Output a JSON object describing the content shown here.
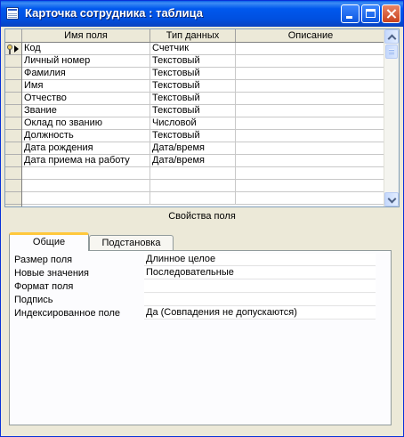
{
  "window": {
    "title": "Карточка сотрудника : таблица"
  },
  "grid": {
    "headers": [
      "Имя поля",
      "Тип данных",
      "Описание"
    ],
    "rows": [
      {
        "name": "Код",
        "type": "Счетчик",
        "desc": ""
      },
      {
        "name": "Личный номер",
        "type": "Текстовый",
        "desc": ""
      },
      {
        "name": "Фамилия",
        "type": "Текстовый",
        "desc": ""
      },
      {
        "name": "Имя",
        "type": "Текстовый",
        "desc": ""
      },
      {
        "name": "Отчество",
        "type": "Текстовый",
        "desc": ""
      },
      {
        "name": "Звание",
        "type": "Текстовый",
        "desc": ""
      },
      {
        "name": "Оклад по званию",
        "type": "Числовой",
        "desc": ""
      },
      {
        "name": "Должность",
        "type": "Текстовый",
        "desc": ""
      },
      {
        "name": "Дата рождения",
        "type": "Дата/время",
        "desc": ""
      },
      {
        "name": "Дата приема на работу",
        "type": "Дата/время",
        "desc": ""
      },
      {
        "name": "",
        "type": "",
        "desc": ""
      },
      {
        "name": "",
        "type": "",
        "desc": ""
      },
      {
        "name": "",
        "type": "",
        "desc": ""
      }
    ]
  },
  "properties": {
    "title": "Свойства поля",
    "tabs": [
      "Общие",
      "Подстановка"
    ],
    "items": [
      {
        "label": "Размер поля",
        "value": "Длинное целое"
      },
      {
        "label": "Новые значения",
        "value": "Последовательные"
      },
      {
        "label": "Формат поля",
        "value": ""
      },
      {
        "label": "Подпись",
        "value": ""
      },
      {
        "label": "Индексированное поле",
        "value": "Да (Совпадения не допускаются)"
      }
    ]
  }
}
